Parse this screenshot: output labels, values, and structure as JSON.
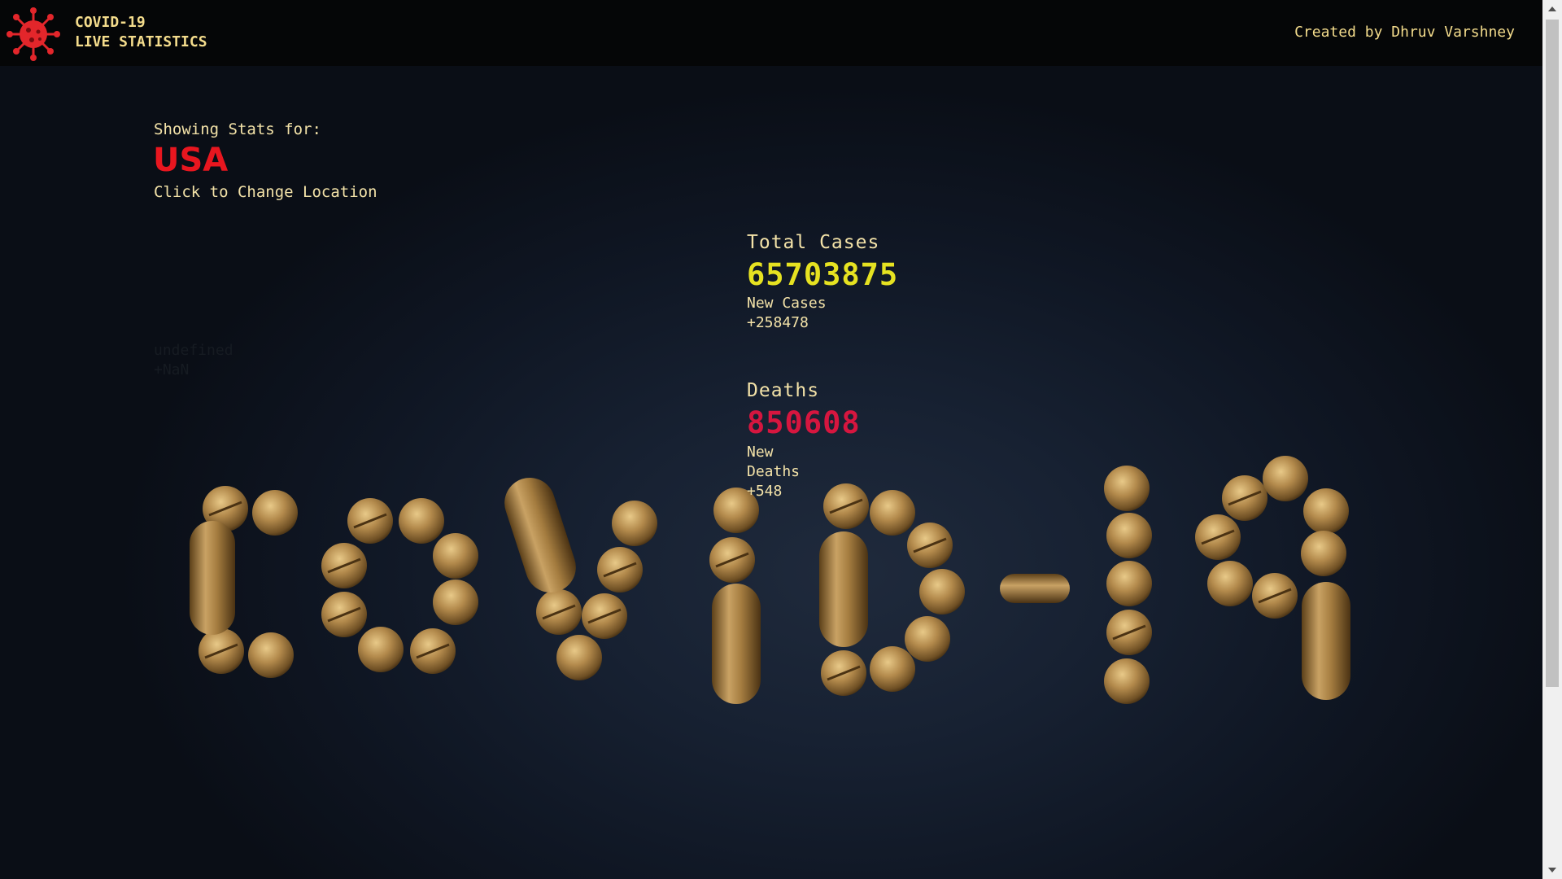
{
  "header": {
    "brand_line1": "COVID-19",
    "brand_line2": "LIVE STATISTICS",
    "credit": "Created by Dhruv Varshney",
    "logo_icon": "virus-icon"
  },
  "location": {
    "label": "Showing Stats for:",
    "country": "USA",
    "change_link": "Click to Change Location",
    "undefined_label": "undefined",
    "undefined_value": "+NaN"
  },
  "stats": {
    "cases": {
      "title": "Total Cases",
      "total": "65703875",
      "new_label": "New Cases",
      "new_value": "+258478"
    },
    "deaths": {
      "title": "Deaths",
      "total": "850608",
      "new_label_line1": "New",
      "new_label_line2": "Deaths",
      "new_value": "+548"
    }
  },
  "colors": {
    "header_bg": "#050607",
    "brand_text": "#f4dc8c",
    "country": "#e8161f",
    "cases_number": "#e6e221",
    "deaths_number": "#d6163f",
    "pill_gold": "#b8914f"
  }
}
